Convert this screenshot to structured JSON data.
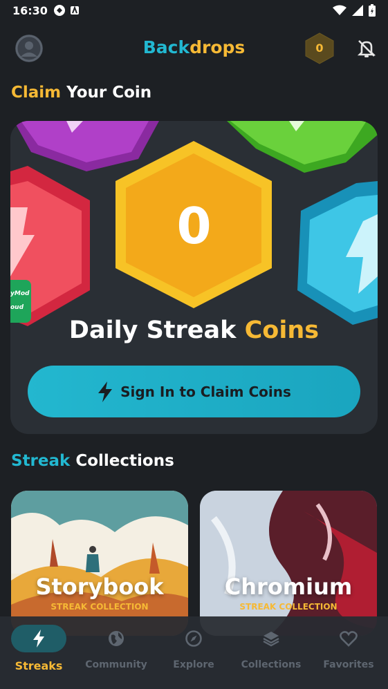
{
  "status_bar": {
    "time": "16:30"
  },
  "header": {
    "title_part1": "Back",
    "title_part2": "drops",
    "coin_count": "0"
  },
  "claim_section": {
    "title_accent": "Claim",
    "title_rest": "Your Coin",
    "coin_value": "0",
    "streak_label": "Daily Streak",
    "streak_label_accent": "Coins",
    "button_label": "Sign In to Claim Coins",
    "mod_tag_line1": "yMod",
    "mod_tag_line2": "oud"
  },
  "collections_section": {
    "title_accent": "Streak",
    "title_rest": "Collections",
    "cards": [
      {
        "title": "Storybook",
        "subtitle": "STREAK COLLECTION"
      },
      {
        "title": "Chromium",
        "subtitle": "STREAK COLLECTION"
      }
    ]
  },
  "bottom_nav": {
    "items": [
      {
        "label": "Streaks",
        "icon": "bolt-icon",
        "active": true
      },
      {
        "label": "Community",
        "icon": "globe-icon"
      },
      {
        "label": "Explore",
        "icon": "compass-icon"
      },
      {
        "label": "Collections",
        "icon": "layers-icon"
      },
      {
        "label": "Favorites",
        "icon": "heart-icon"
      }
    ]
  },
  "colors": {
    "accent_yellow": "#f6b935",
    "accent_cyan": "#22b8d1",
    "background": "#1d2024"
  }
}
